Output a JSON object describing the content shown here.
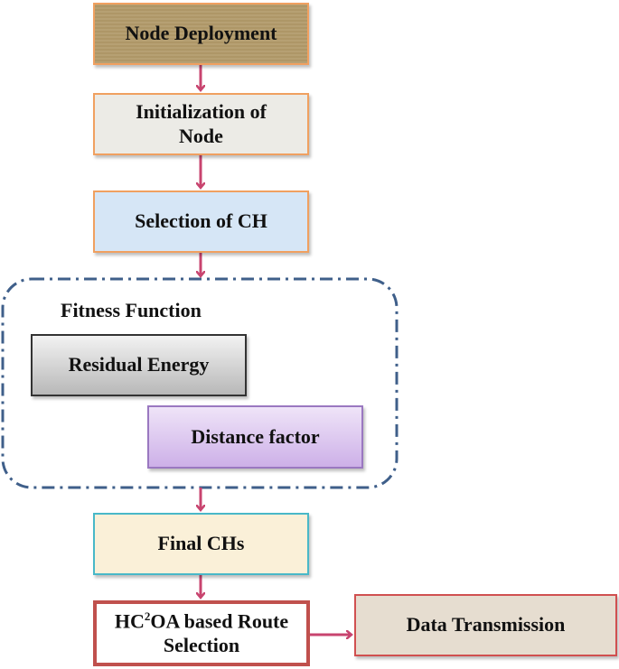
{
  "nodes": {
    "node_deployment": "Node Deployment",
    "initialization": "Initialization of Node",
    "selection_ch": "Selection of CH",
    "fitness_function": "Fitness Function",
    "residual_energy": "Residual Energy",
    "distance_factor": "Distance factor",
    "final_chs": "Final CHs",
    "route_pre": "HC",
    "route_sup": "2",
    "route_post": "OA based Route Selection",
    "data_transmission": "Data Transmission"
  },
  "colors": {
    "arrow": "#c8446f",
    "group_border": "#3f5f8a",
    "route_border": "#c0504d"
  }
}
